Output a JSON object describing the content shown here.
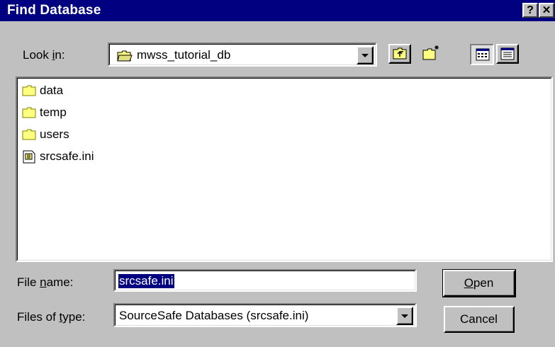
{
  "window": {
    "title": "Find Database",
    "help_button": "?",
    "close_button": "✕"
  },
  "look_in": {
    "label_prefix": "Look ",
    "label_accel": "i",
    "label_suffix": "n:",
    "value": "mwss_tutorial_db",
    "icon": "folder-open-icon"
  },
  "toolbar": {
    "up_one_level": "up-folder-icon",
    "new_folder": "new-folder-icon",
    "list_view": "list-view-icon",
    "details_view": "details-view-icon"
  },
  "files": [
    {
      "name": "data",
      "icon": "folder-icon"
    },
    {
      "name": "temp",
      "icon": "folder-icon"
    },
    {
      "name": "users",
      "icon": "folder-icon"
    },
    {
      "name": "srcsafe.ini",
      "icon": "ini-file-icon"
    }
  ],
  "file_name": {
    "label_prefix": "File ",
    "label_accel": "n",
    "label_suffix": "ame:",
    "value": "srcsafe.ini"
  },
  "file_type": {
    "label_prefix": "Files of ",
    "label_accel": "t",
    "label_suffix": "ype:",
    "value": "SourceSafe Databases (srcsafe.ini)"
  },
  "buttons": {
    "open_accel": "O",
    "open_rest": "pen",
    "cancel": "Cancel"
  },
  "colors": {
    "titlebar": "#000080",
    "face": "#c0c0c0",
    "selection": "#000080",
    "folder": "#ffff80"
  }
}
